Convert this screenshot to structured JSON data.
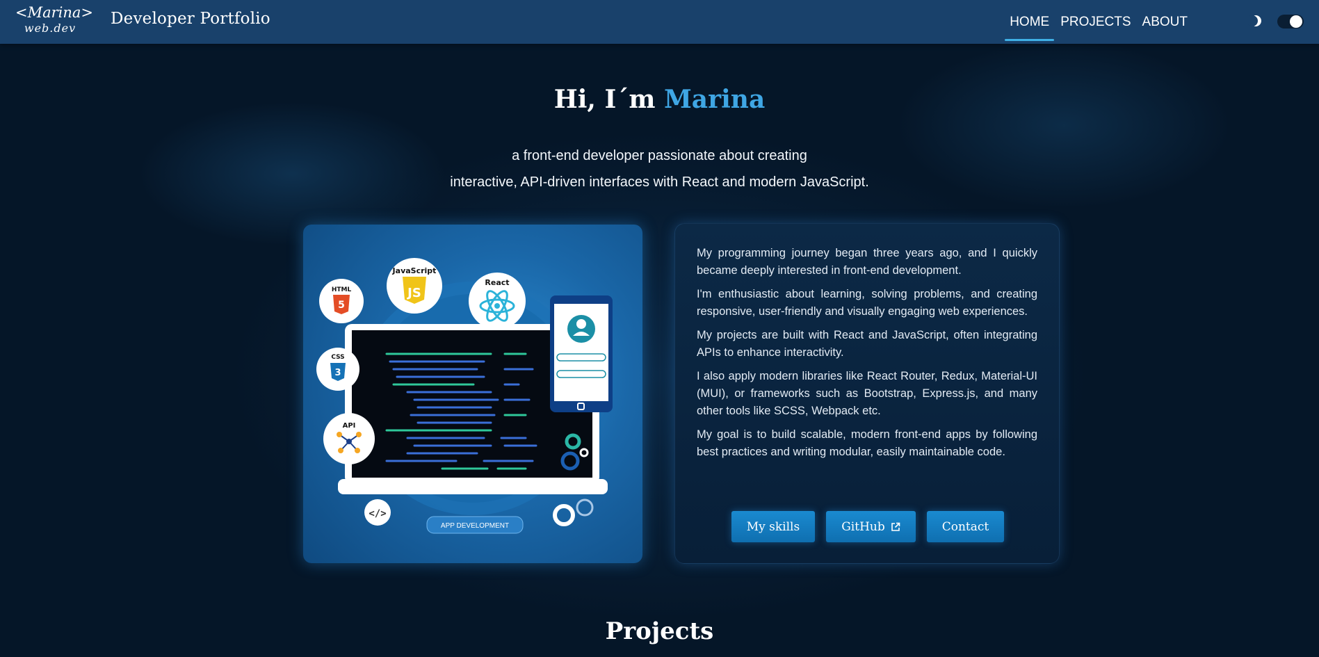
{
  "nav": {
    "logo_line1": "<Marina>",
    "logo_line2": "web.dev",
    "brand": "Developer Portfolio",
    "links": [
      {
        "label": "HOME",
        "active": true
      },
      {
        "label": "PROJECTS",
        "active": false
      },
      {
        "label": "ABOUT",
        "active": false
      }
    ],
    "theme_icon": "moon-icon",
    "toggle_on": true
  },
  "hero": {
    "greeting": "Hi, I´m ",
    "name": "Marina",
    "subtitle_line1": "a front-end developer passionate about creating",
    "subtitle_line2": "interactive, API-driven interfaces with React and modern JavaScript."
  },
  "illustration": {
    "labels": {
      "html": "HTML",
      "css": "CSS",
      "js": "JavaScript",
      "react": "React",
      "api": "API",
      "banner": "APP DEVELOPMENT"
    }
  },
  "about": {
    "paragraphs": [
      "My programming journey began three years ago, and I quickly became deeply interested in front-end development.",
      "I'm enthusiastic about learning, solving problems, and creating responsive, user-friendly and visually engaging web experiences.",
      "My projects are built with React and JavaScript, often integrating APIs to enhance interactivity.",
      "I also apply modern libraries like React Router, Redux, Material-UI (MUI), or frameworks such as Bootstrap, Express.js, and many other tools like SCSS, Webpack etc.",
      "My goal is to build scalable, modern front-end apps by following best practices and writing modular, easily maintainable code."
    ],
    "buttons": {
      "skills": "My skills",
      "github": "GitHub",
      "contact": "Contact"
    }
  },
  "section": {
    "projects_heading": "Projects"
  },
  "colors": {
    "background": "#051628",
    "navbar": "#19416b",
    "accent": "#3fa6e4",
    "button": "#1a8ad0"
  }
}
